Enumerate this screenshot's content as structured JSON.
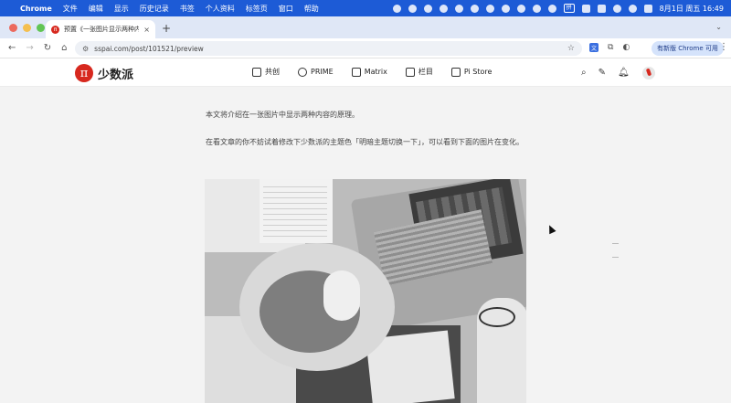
{
  "menubar": {
    "apple_glyph": "",
    "app_name": "Chrome",
    "menus": [
      "文件",
      "编辑",
      "显示",
      "历史记录",
      "书签",
      "个人资料",
      "标签页",
      "窗口",
      "帮助"
    ],
    "keyboard_indicator": "拼",
    "clock": "8月1日 周五  16:49"
  },
  "browser": {
    "tab_title": "预置《一张图片显示两种内容的原理》",
    "favicon_letter": "π",
    "url": "sspai.com/post/101521/preview",
    "update_button_label": "有新版 Chrome 可用",
    "translate_icon_glyph": "文"
  },
  "site": {
    "logo_mark": "π",
    "logo_name": "少数派",
    "nav": [
      "共创",
      "PRIME",
      "Matrix",
      "栏目",
      "Pi Store"
    ]
  },
  "article": {
    "paragraph1": "本文将介绍在一张图片中显示两种内容的原理。",
    "paragraph2": "在看文章的你不妨试着修改下少数派的主题色「明暗主题切换一下」，可以看到下面的图片在变化。"
  },
  "colors": {
    "menubar": "#1d5bd6",
    "brand_red": "#d7281e",
    "page_bg": "#f3f3f3"
  }
}
